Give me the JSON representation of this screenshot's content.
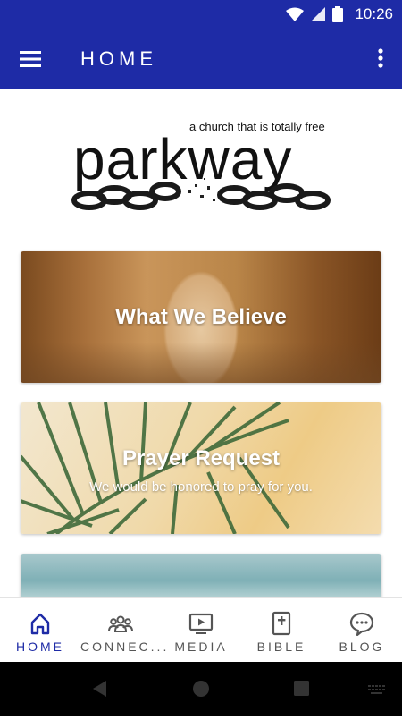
{
  "status_bar": {
    "time": "10:26"
  },
  "app_bar": {
    "title": "HOME"
  },
  "logo": {
    "name": "parkway",
    "tagline": "a church that is totally free"
  },
  "cards": [
    {
      "title": "What We Believe",
      "subtitle": ""
    },
    {
      "title": "Prayer Request",
      "subtitle": "We would be honored to pray for you."
    }
  ],
  "bottom_nav": [
    {
      "label": "HOME",
      "icon": "home-icon",
      "active": true
    },
    {
      "label": "CONNEC...",
      "icon": "people-icon",
      "active": false
    },
    {
      "label": "MEDIA",
      "icon": "video-icon",
      "active": false
    },
    {
      "label": "BIBLE",
      "icon": "bible-icon",
      "active": false
    },
    {
      "label": "BLOG",
      "icon": "chat-bubble-icon",
      "active": false
    }
  ],
  "colors": {
    "primary": "#1e2ba6",
    "nav_inactive": "#555555"
  }
}
